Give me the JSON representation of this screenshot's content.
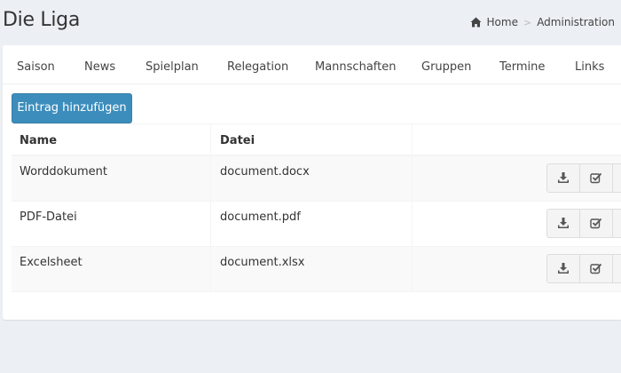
{
  "header": {
    "title": "Die Liga",
    "breadcrumb": {
      "home": "Home",
      "separator": ">",
      "current": "Administration"
    }
  },
  "tabs": [
    {
      "label": "Saison"
    },
    {
      "label": "News"
    },
    {
      "label": "Spielplan"
    },
    {
      "label": "Relegation"
    },
    {
      "label": "Mannschaften"
    },
    {
      "label": "Gruppen"
    },
    {
      "label": "Termine"
    },
    {
      "label": "Links"
    }
  ],
  "toolbar": {
    "add_label": "Eintrag hinzufügen"
  },
  "table": {
    "columns": [
      "Name",
      "Datei",
      ""
    ],
    "rows": [
      {
        "name": "Worddokument",
        "file": "document.docx"
      },
      {
        "name": "PDF-Datei",
        "file": "document.pdf"
      },
      {
        "name": "Excelsheet",
        "file": "document.xlsx"
      }
    ]
  },
  "colors": {
    "primary": "#3c8dbc",
    "background": "#ecf0f5",
    "box": "#ffffff"
  },
  "icons": {
    "home": "home-icon",
    "download": "download-icon",
    "check": "check-square-icon"
  }
}
